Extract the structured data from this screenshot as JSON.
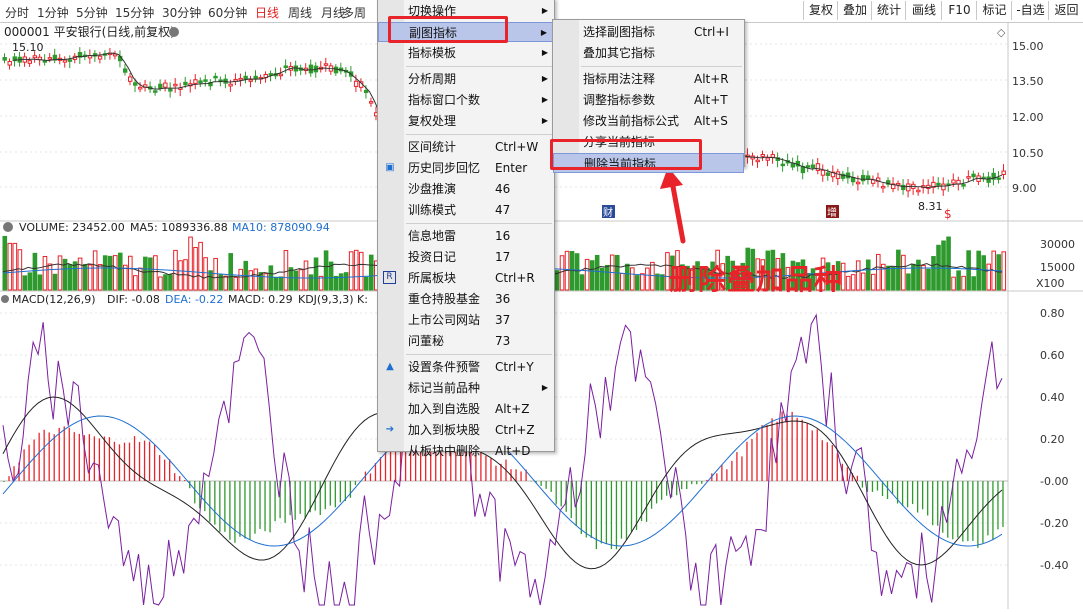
{
  "periods": [
    "分时",
    "1分钟",
    "5分钟",
    "15分钟",
    "30分钟",
    "60分钟",
    "日线",
    "周线",
    "月线",
    "多周"
  ],
  "active_period": "日线",
  "right_tools": [
    "复权",
    "叠加",
    "统计",
    "画线",
    "F10",
    "标记",
    "-自选",
    "返回"
  ],
  "price_panel": {
    "title": "000001 平安银行(日线,前复权)",
    "high_label": "15.10",
    "low_label": "8.31",
    "yaxis": [
      "15.00",
      "13.50",
      "12.00",
      "10.50",
      "9.00"
    ],
    "markers": [
      "财",
      "增",
      "$"
    ]
  },
  "volume_panel": {
    "vol": "VOLUME: 23452.00",
    "ma5": "MA5: 1089336.88",
    "ma10": "MA10: 878090.94",
    "yaxis": [
      "30000",
      "15000",
      "X100"
    ]
  },
  "macd_panel": {
    "macd_label": "MACD(12,26,9)",
    "dif": "DIF: -0.08",
    "dea": "DEA: -0.22",
    "macd": "MACD: 0.29",
    "kdj": "KDJ(9,3,3) K:",
    "yaxis": [
      "0.80",
      "0.60",
      "0.40",
      "0.20",
      "-0.00",
      "-0.20",
      "-0.40"
    ]
  },
  "main_menu": [
    {
      "label": "切换操作",
      "arrow": true
    },
    {
      "label": "副图指标",
      "arrow": true,
      "highlight": true
    },
    {
      "label": "指标模板",
      "arrow": true
    },
    {
      "sep": true
    },
    {
      "label": "分析周期",
      "arrow": true
    },
    {
      "label": "指标窗口个数",
      "arrow": true
    },
    {
      "label": "复权处理",
      "arrow": true
    },
    {
      "sep": true
    },
    {
      "label": "区间统计",
      "shortcut": "Ctrl+W"
    },
    {
      "label": "历史同步回忆",
      "shortcut": "Enter",
      "icon": "history-icon"
    },
    {
      "label": "沙盘推演",
      "shortcut": "46"
    },
    {
      "label": "训练模式",
      "shortcut": "47"
    },
    {
      "sep": true
    },
    {
      "label": "信息地雷",
      "shortcut": "16"
    },
    {
      "label": "投资日记",
      "shortcut": "17"
    },
    {
      "label": "所属板块",
      "shortcut": "Ctrl+R",
      "icon": "r-icon"
    },
    {
      "label": "重仓持股基金",
      "shortcut": "36"
    },
    {
      "label": "上市公司网站",
      "shortcut": "37"
    },
    {
      "label": "问董秘",
      "shortcut": "73"
    },
    {
      "sep": true
    },
    {
      "label": "设置条件预警",
      "shortcut": "Ctrl+Y",
      "icon": "alert-icon"
    },
    {
      "label": "标记当前品种",
      "arrow": true
    },
    {
      "label": "加入到自选股",
      "shortcut": "Alt+Z"
    },
    {
      "label": "加入到板块股",
      "shortcut": "Ctrl+Z",
      "icon": "add-block-icon"
    },
    {
      "label": "从板块中删除",
      "shortcut": "Alt+D"
    }
  ],
  "sub_menu": [
    {
      "label": "选择副图指标",
      "shortcut": "Ctrl+I"
    },
    {
      "label": "叠加其它指标",
      "shortcut": ""
    },
    {
      "sep": true
    },
    {
      "label": "指标用法注释",
      "shortcut": "Alt+R"
    },
    {
      "label": "调整指标参数",
      "shortcut": "Alt+T"
    },
    {
      "label": "修改当前指标公式",
      "shortcut": "Alt+S"
    },
    {
      "label": "分享当前指标",
      "shortcut": ""
    },
    {
      "label": "删除当前指标",
      "shortcut": "",
      "highlight": true
    }
  ],
  "callout": "删除叠加品种",
  "colors": {
    "up": "#e8232a",
    "down": "#2e9a2e",
    "accent": "#e8232a",
    "dif": "#222222",
    "dea": "#1f6fd0",
    "k": "#7a1fa0"
  }
}
